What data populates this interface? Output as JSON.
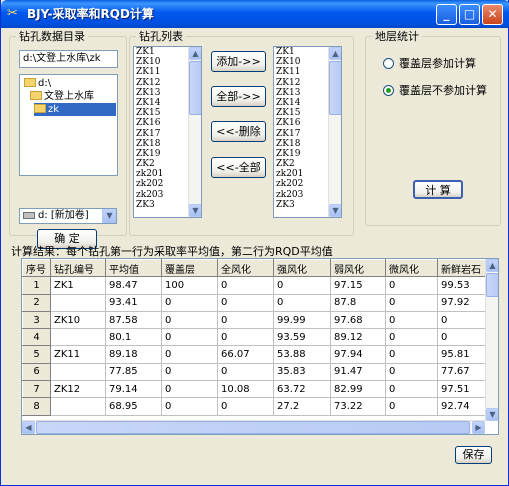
{
  "window": {
    "title": "BJY-采取率和RQD计算",
    "controls": [
      "minimize-icon",
      "maximize-icon",
      "close-icon"
    ]
  },
  "dir_group": {
    "legend": "钻孔数据目录",
    "path": "d:\\文登上水库\\zk",
    "tree": [
      "d:\\",
      "文登上水库",
      "zk"
    ],
    "drive": "d: [新加卷]",
    "confirm": "确 定"
  },
  "list_group": {
    "legend": "钻孔列表",
    "left_items": [
      "ZK1",
      "ZK10",
      "ZK11",
      "ZK12",
      "ZK13",
      "ZK14",
      "ZK15",
      "ZK16",
      "ZK17",
      "ZK18",
      "ZK19",
      "ZK2",
      "zk201",
      "zk202",
      "zk203",
      "ZK3"
    ],
    "right_items": [
      "ZK1",
      "ZK10",
      "ZK11",
      "ZK12",
      "ZK13",
      "ZK14",
      "ZK15",
      "ZK16",
      "ZK17",
      "ZK18",
      "ZK19",
      "ZK2",
      "zk201",
      "zk202",
      "zk203",
      "ZK3"
    ],
    "add": "添加->>",
    "add_all": "全部->>",
    "remove": "<<-删除",
    "remove_all": "<<-全部"
  },
  "strata_group": {
    "legend": "地层统计",
    "opt1": "覆盖层参加计算",
    "opt2": "覆盖层不参加计算",
    "selected": "opt2",
    "calc": "计 算"
  },
  "results": {
    "label": "计算结果：每个钻孔第一行为采取率平均值，第二行为RQD平均值",
    "columns": [
      "序号",
      "钻孔编号",
      "平均值",
      "覆盖层",
      "全风化",
      "强风化",
      "弱风化",
      "微风化",
      "新鲜岩石"
    ],
    "rows": [
      [
        "1",
        "ZK1",
        "98.47",
        "100",
        "0",
        "0",
        "97.15",
        "0",
        "99.53"
      ],
      [
        "2",
        "",
        "93.41",
        "0",
        "0",
        "0",
        "87.8",
        "0",
        "97.92"
      ],
      [
        "3",
        "ZK10",
        "87.58",
        "0",
        "0",
        "99.99",
        "97.68",
        "0",
        "0"
      ],
      [
        "4",
        "",
        "80.1",
        "0",
        "0",
        "93.59",
        "89.12",
        "0",
        "0"
      ],
      [
        "5",
        "ZK11",
        "89.18",
        "0",
        "66.07",
        "53.88",
        "97.94",
        "0",
        "95.81"
      ],
      [
        "6",
        "",
        "77.85",
        "0",
        "0",
        "35.83",
        "91.47",
        "0",
        "77.67"
      ],
      [
        "7",
        "ZK12",
        "79.14",
        "0",
        "10.08",
        "63.72",
        "82.99",
        "0",
        "97.51"
      ],
      [
        "8",
        "",
        "68.95",
        "0",
        "0",
        "27.2",
        "73.22",
        "0",
        "92.74"
      ]
    ],
    "save": "保存"
  }
}
